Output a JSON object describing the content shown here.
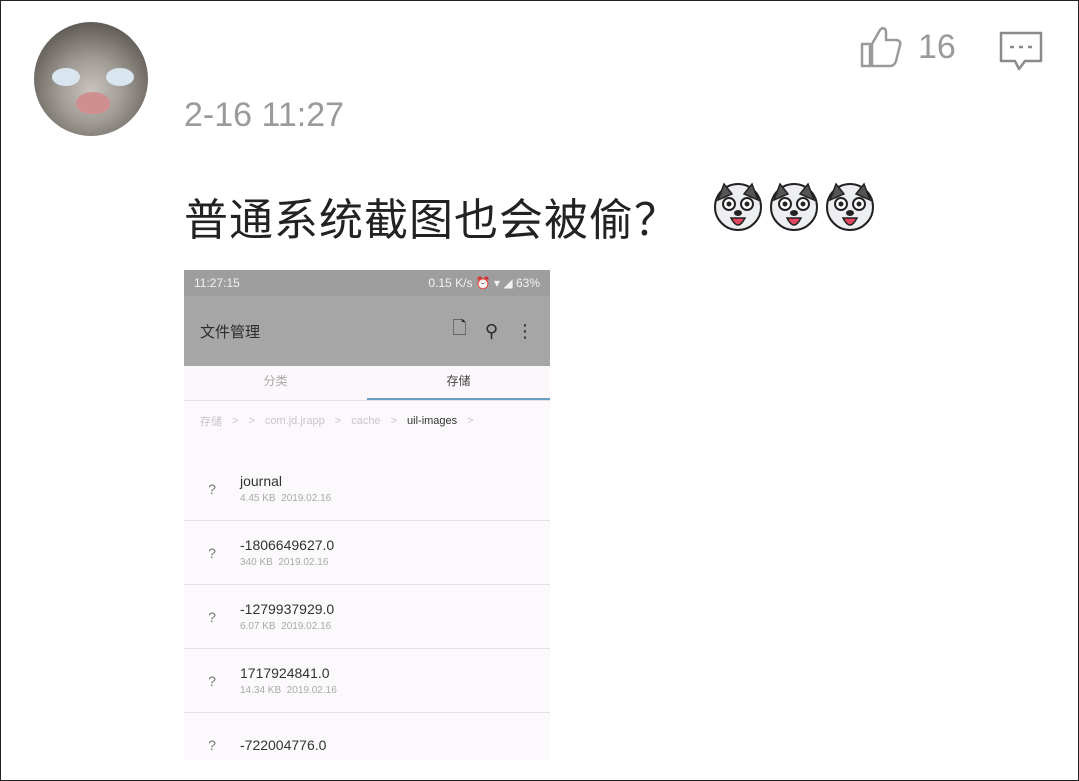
{
  "post": {
    "timestamp": "2-16 11:27",
    "likes": "16",
    "text": "普通系统截图也会被偷？",
    "emoji_count": 3,
    "icons": {
      "like": "thumbs-up-icon",
      "comment": "comment-icon",
      "emoji": "husky-dog-emoji"
    }
  },
  "screenshot": {
    "status": {
      "time": "11:27:15",
      "right": "0.15 K/s ⏰ ▾ ◢ 63%"
    },
    "app_title": "文件管理",
    "tabs": [
      "分类",
      "存储"
    ],
    "breadcrumbs": [
      "存储",
      ">",
      ">",
      "com.jd.jrapp",
      ">",
      "cache",
      ">",
      "uil-images",
      ">"
    ],
    "files": [
      {
        "name": "journal",
        "size": "4.45 KB",
        "date": "2019.02.16"
      },
      {
        "name": "-1806649627.0",
        "size": "340 KB",
        "date": "2019.02.16"
      },
      {
        "name": "-1279937929.0",
        "size": "6.07 KB",
        "date": "2019.02.16"
      },
      {
        "name": "1717924841.0",
        "size": "14.34 KB",
        "date": "2019.02.16"
      },
      {
        "name": "-722004776.0",
        "size": "",
        "date": ""
      }
    ]
  }
}
